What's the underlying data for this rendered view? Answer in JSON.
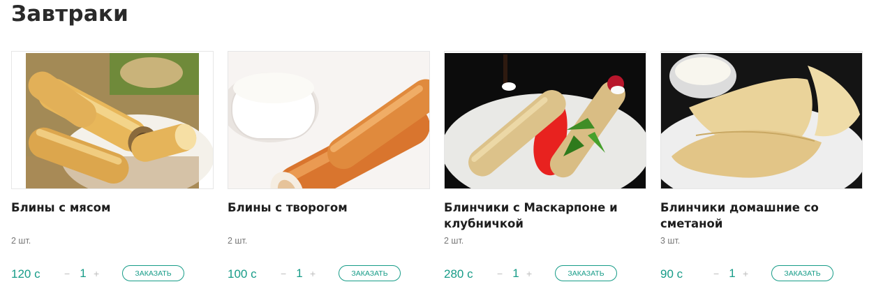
{
  "page": {
    "title": "Завтраки"
  },
  "products": [
    {
      "name": "Блины с мясом",
      "amount": "2 шт.",
      "price": "120 с",
      "quantity": "1",
      "minus": "−",
      "plus": "+",
      "order_label": "Заказать",
      "image": "pancake-rolls-with-meat-photo"
    },
    {
      "name": "Блины с творогом",
      "amount": "2 шт.",
      "price": "100 с",
      "quantity": "1",
      "minus": "−",
      "plus": "+",
      "order_label": "Заказать",
      "image": "pancake-rolls-with-cottage-cheese-photo"
    },
    {
      "name": "Блинчики с Маскарпоне и клубничкой",
      "amount": "2 шт.",
      "price": "280 с",
      "quantity": "1",
      "minus": "−",
      "plus": "+",
      "order_label": "Заказать",
      "image": "crepes-with-mascarpone-and-strawberry-photo"
    },
    {
      "name": "Блинчики домашние со сметаной",
      "amount": "3 шт.",
      "price": "90 с",
      "quantity": "1",
      "minus": "−",
      "plus": "+",
      "order_label": "Заказать",
      "image": "homemade-crepes-with-sour-cream-photo"
    }
  ],
  "colors": {
    "accent": "#179c88",
    "title": "#2a2a2a",
    "muted": "#777777"
  }
}
